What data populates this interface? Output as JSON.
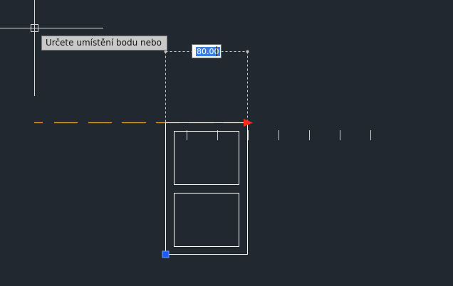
{
  "prompt": {
    "tooltip_text": "Určete umístění bodu nebo",
    "dimension_value": "80.00"
  },
  "colors": {
    "background": "#212830",
    "geometry": "#ffffff",
    "crosshair": "#dcdcdc",
    "tracking_line": "#e3a23a",
    "arrow_marker": "#ff2a1a",
    "grip": "#1a5cff",
    "dimension_line": "#cfcfcf"
  },
  "icons": {
    "cursor": "crosshair-cursor-icon",
    "tracking_arrow": "arrow-right-icon",
    "grip": "square-grip-icon"
  }
}
